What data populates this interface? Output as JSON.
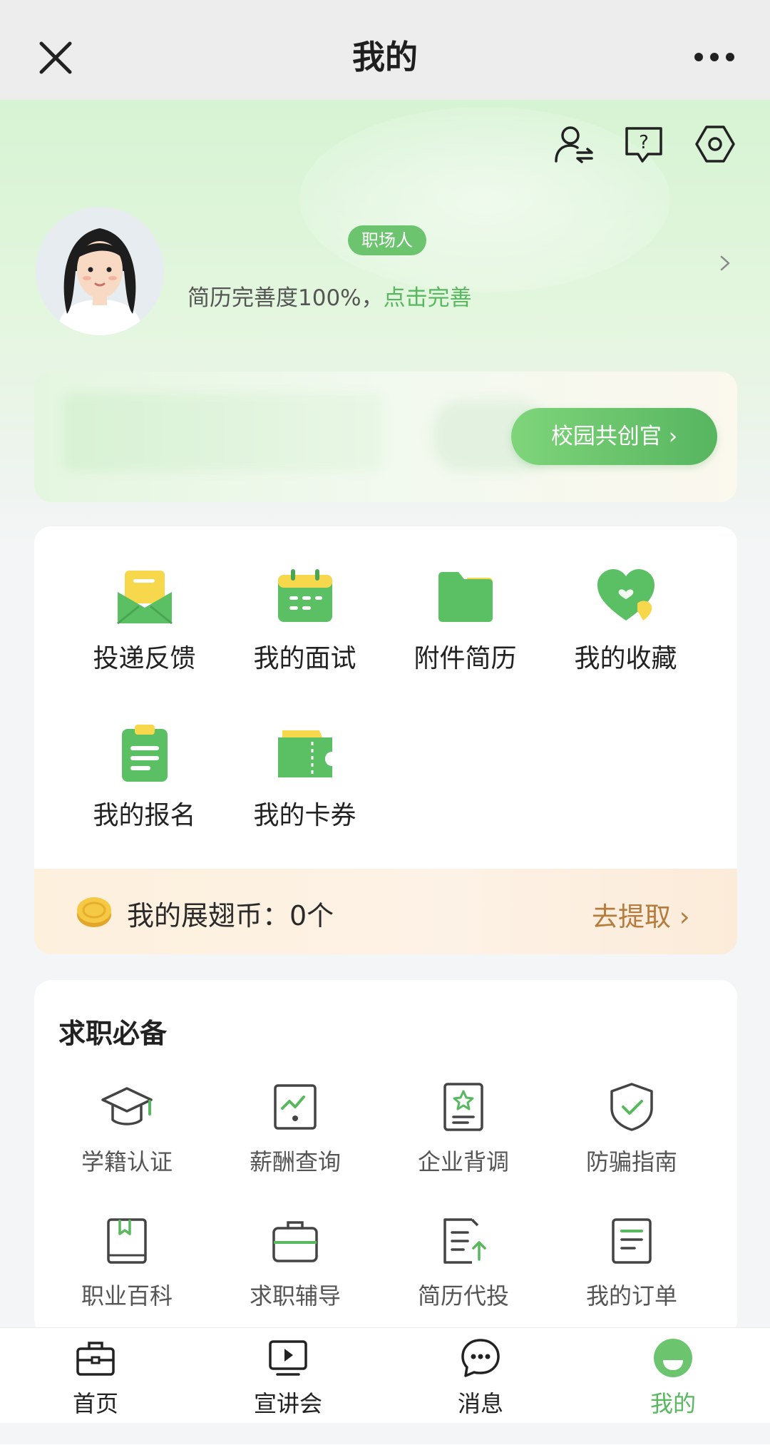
{
  "nav": {
    "title": "我的",
    "close_icon": "close-icon",
    "more_icon": "more-dots-icon"
  },
  "header": {
    "icons": [
      "switch-identity-icon",
      "help-icon",
      "settings-icon"
    ],
    "badge": "职场人",
    "resume_text": "简历完善度100%，",
    "resume_link": "点击完善"
  },
  "campus": {
    "button_label": "校园共创官 ›"
  },
  "functions": {
    "items": [
      {
        "label": "投递反馈",
        "icon": "envelope-icon"
      },
      {
        "label": "我的面试",
        "icon": "calendar-icon"
      },
      {
        "label": "附件简历",
        "icon": "folder-icon"
      },
      {
        "label": "我的收藏",
        "icon": "heart-icon"
      },
      {
        "label": "我的报名",
        "icon": "clipboard-icon"
      },
      {
        "label": "我的卡券",
        "icon": "coupon-icon"
      }
    ]
  },
  "coins": {
    "label": "我的展翅币：0个",
    "action": "去提取 ›"
  },
  "essentials": {
    "title": "求职必备",
    "items": [
      {
        "label": "学籍认证",
        "icon": "graduation-cap-icon"
      },
      {
        "label": "薪酬查询",
        "icon": "salary-chart-icon"
      },
      {
        "label": "企业背调",
        "icon": "badge-document-icon"
      },
      {
        "label": "防骗指南",
        "icon": "shield-check-icon"
      },
      {
        "label": "职业百科",
        "icon": "book-icon"
      },
      {
        "label": "求职辅导",
        "icon": "briefcase-icon"
      },
      {
        "label": "简历代投",
        "icon": "resume-upload-icon"
      },
      {
        "label": "我的订单",
        "icon": "order-list-icon"
      }
    ]
  },
  "tabs": [
    {
      "label": "首页",
      "icon": "home-briefcase-icon",
      "active": false
    },
    {
      "label": "宣讲会",
      "icon": "play-screen-icon",
      "active": false
    },
    {
      "label": "消息",
      "icon": "chat-bubble-icon",
      "active": false
    },
    {
      "label": "我的",
      "icon": "profile-face-icon",
      "active": true
    }
  ],
  "colors": {
    "accent": "#58b85f",
    "coin_action": "#b67c3d",
    "badge": "#6cc46f"
  }
}
